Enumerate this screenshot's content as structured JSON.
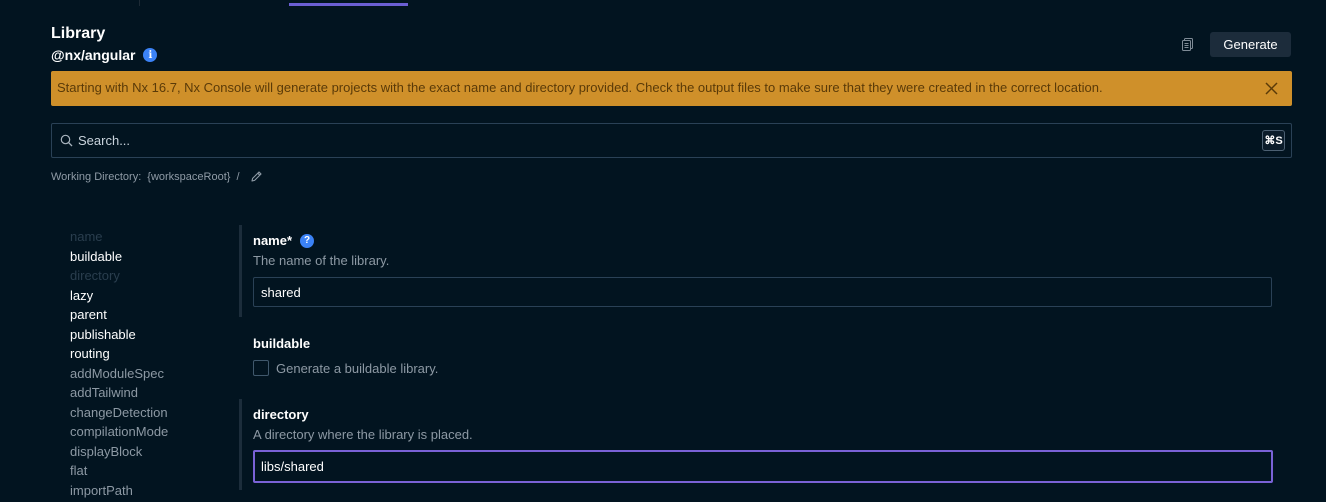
{
  "header": {
    "title": "Library",
    "subtitle": "@nx/angular",
    "info_icon": "i",
    "generate_label": "Generate"
  },
  "banner": {
    "text": "Starting with Nx 16.7, Nx Console will generate projects with the exact name and directory provided. Check the output files to make sure that they were created in the correct location.",
    "color": "#cf902a"
  },
  "search": {
    "placeholder": "Search...",
    "shortcut": "⌘S"
  },
  "working_directory": {
    "label": "Working Directory:",
    "value": "{workspaceRoot}",
    "separator": "/"
  },
  "sidebar": {
    "items": [
      {
        "label": "name"
      },
      {
        "label": "buildable"
      },
      {
        "label": "directory"
      },
      {
        "label": "lazy"
      },
      {
        "label": "parent"
      },
      {
        "label": "publishable"
      },
      {
        "label": "routing"
      },
      {
        "label": "addModuleSpec"
      },
      {
        "label": "addTailwind"
      },
      {
        "label": "changeDetection"
      },
      {
        "label": "compilationMode"
      },
      {
        "label": "displayBlock"
      },
      {
        "label": "flat"
      },
      {
        "label": "importPath"
      }
    ]
  },
  "form": {
    "name": {
      "label": "name*",
      "help_icon": "?",
      "description": "The name of the library.",
      "value": "shared"
    },
    "buildable": {
      "label": "buildable",
      "checkbox_label": "Generate a buildable library.",
      "checked": false
    },
    "directory": {
      "label": "directory",
      "description": "A directory where the library is placed.",
      "value": "libs/shared"
    }
  },
  "colors": {
    "background": "#021420",
    "accent": "#7a62d6",
    "info": "#3b82f6",
    "warning": "#cf902a"
  }
}
